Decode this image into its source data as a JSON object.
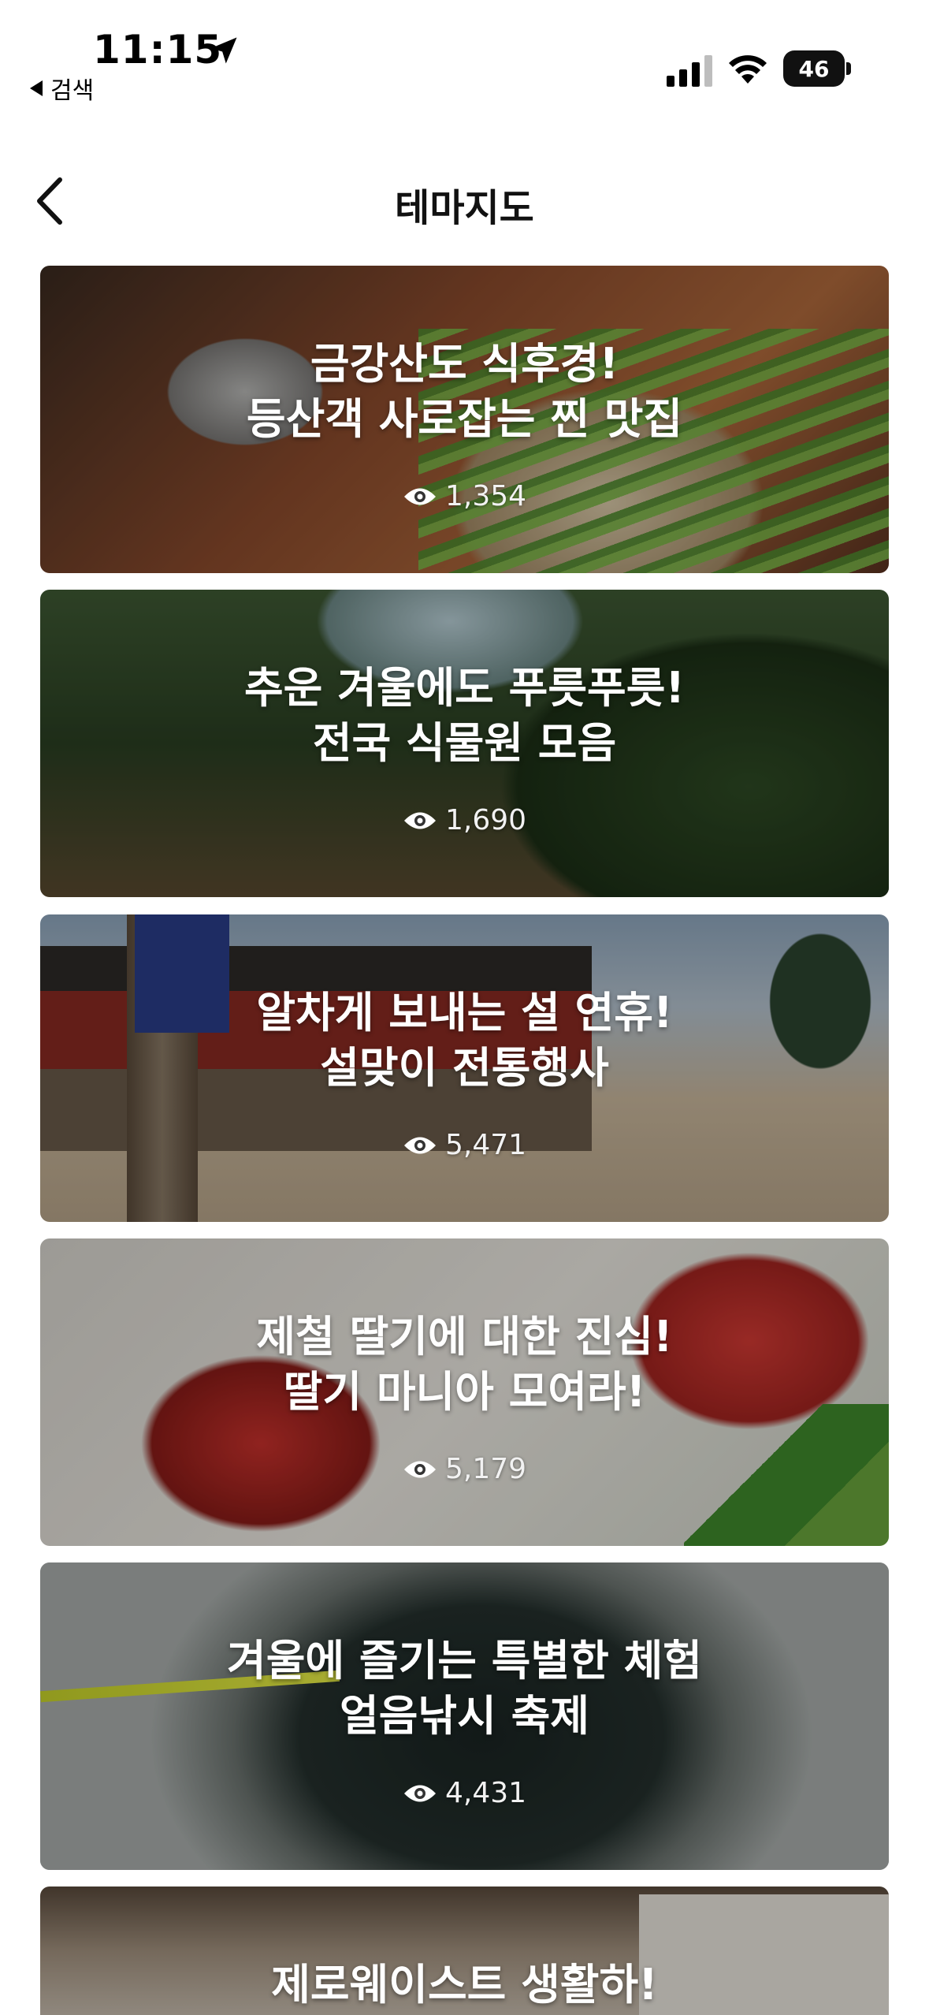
{
  "status_bar": {
    "time": "11:15",
    "back_app_label": "검색",
    "battery_level": "46"
  },
  "header": {
    "title": "테마지도"
  },
  "cards": [
    {
      "title_line1": "금강산도 식후경!",
      "title_line2": "등산객 사로잡는 찐 맛집",
      "views": "1,354"
    },
    {
      "title_line1": "추운 겨울에도 푸릇푸릇!",
      "title_line2": "전국 식물원 모음",
      "views": "1,690"
    },
    {
      "title_line1": "알차게 보내는 설 연휴!",
      "title_line2": "설맞이 전통행사",
      "views": "5,471"
    },
    {
      "title_line1": "제철 딸기에 대한 진심!",
      "title_line2": "딸기 마니아 모여라!",
      "views": "5,179"
    },
    {
      "title_line1": "겨울에 즐기는 특별한 체험",
      "title_line2": "얼음낚시 축제",
      "views": "4,431"
    },
    {
      "title_line1": "제로웨이스트 생활하!",
      "title_line2": "",
      "views": ""
    }
  ]
}
